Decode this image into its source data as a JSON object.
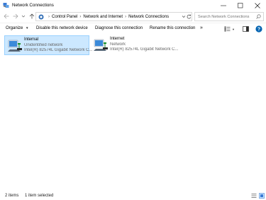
{
  "window": {
    "title": "Network Connections",
    "icon": "network-connections-icon"
  },
  "address": {
    "breadcrumb": [
      "Control Panel",
      "Network and Internet",
      "Network Connections"
    ]
  },
  "search": {
    "placeholder": "Search Network Connections"
  },
  "commands": {
    "organize": "Organize",
    "disable": "Disable this network device",
    "diagnose": "Diagnose this connection",
    "rename": "Rename this connection",
    "more": "»"
  },
  "items": [
    {
      "name": "Internal",
      "status": "Unidentified network",
      "adapter": "Intel(R) 82574L Gigabit Network C...",
      "selected": true
    },
    {
      "name": "Internet",
      "status": "Network",
      "adapter": "Intel(R) 82574L Gigabit Network C...",
      "selected": false
    }
  ],
  "status": {
    "count": "2 items",
    "selection": "1 item selected"
  },
  "colors": {
    "selection_bg": "#cce8ff",
    "selection_border": "#99d1ff",
    "help_blue": "#0063b1"
  }
}
